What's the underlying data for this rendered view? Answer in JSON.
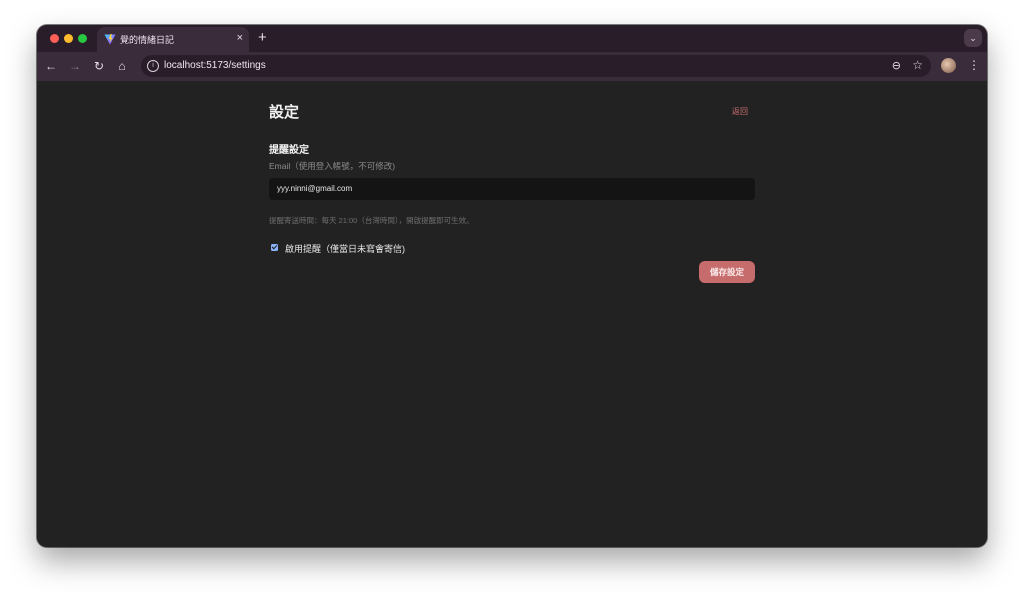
{
  "browser": {
    "tab": {
      "title": "覺的情緒日記",
      "close_glyph": "×",
      "favicon": "vite-logo-icon"
    },
    "new_tab_glyph": "+",
    "tab_menu_glyph": "⌄",
    "toolbar": {
      "back_glyph": "←",
      "forward_glyph": "→",
      "reload_glyph": "↻",
      "home_glyph": "⌂",
      "url": "localhost:5173/settings",
      "info_glyph": "i",
      "zoom_glyph": "⊖",
      "bookmark_glyph": "☆",
      "menu_glyph": "⋮"
    }
  },
  "page": {
    "title": "設定",
    "back_label": "返回",
    "reminder": {
      "section_title": "提醒設定",
      "email_label": "Email（使用登入帳號，不可修改)",
      "email_value": "yyy.ninni@gmail.com",
      "hint": "提醒寄送時間：每天 21:00（台灣時間），開啟提醒即可生效。",
      "enable_checked": true,
      "enable_label": "啟用提醒（僅當日未寫會寄信)",
      "save_label": "儲存設定"
    }
  },
  "colors": {
    "accent": "#c76c6c",
    "link": "#d07070",
    "background": "#222222",
    "browser_chrome": "#3a2c3a"
  }
}
